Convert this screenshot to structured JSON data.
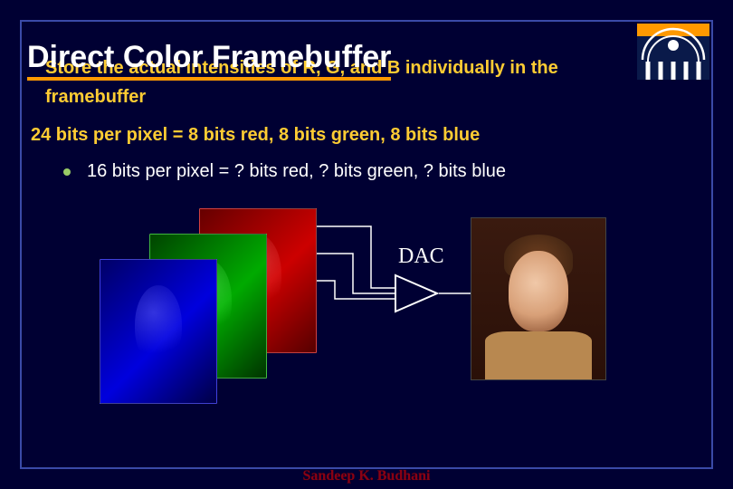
{
  "title": "Direct Color Framebuffer",
  "body": {
    "line1a": "Store the actual intensities of R, G, and B individually in the",
    "line1b": "framebuffer",
    "line2": "24 bits per pixel = 8 bits red, 8 bits green, 8 bits blue",
    "bullet": "16 bits per pixel = ? bits red, ? bits green, ? bits blue"
  },
  "diagram": {
    "dac_label": "DAC"
  },
  "footer": "Sandeep K. Budhani"
}
